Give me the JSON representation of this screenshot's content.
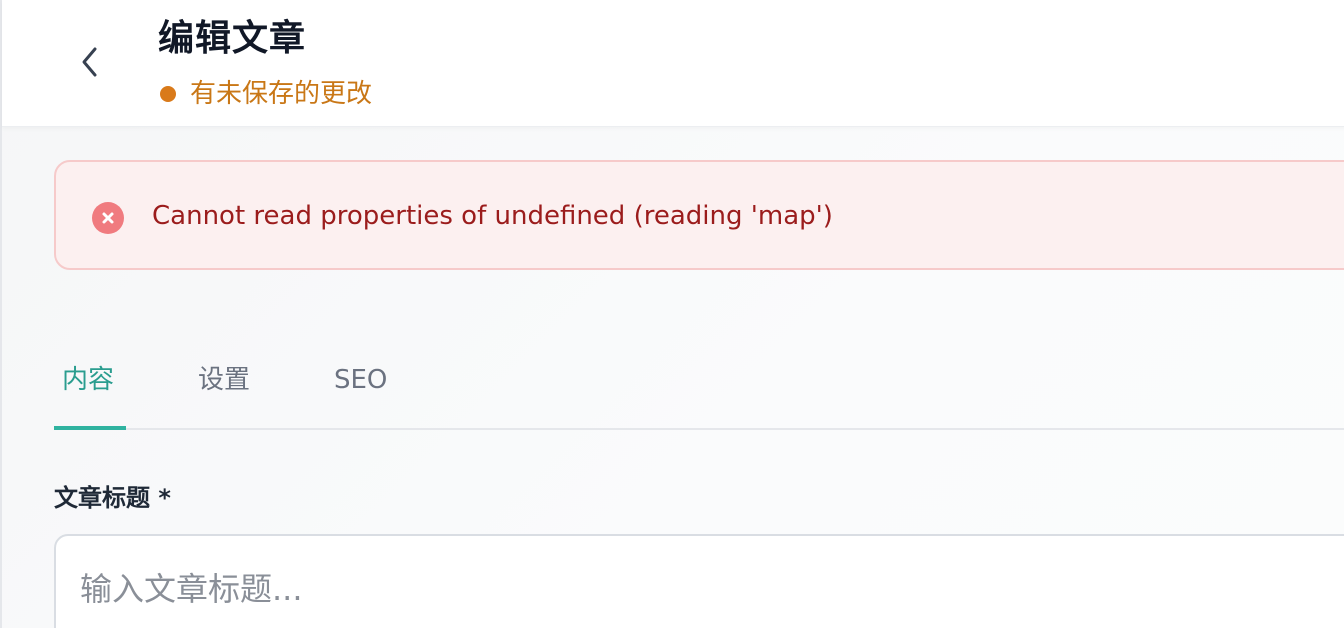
{
  "header": {
    "title": "编辑文章",
    "status_text": "有未保存的更改",
    "status_color": "#d97a1a"
  },
  "alert": {
    "message": "Cannot read properties of undefined (reading 'map')",
    "icon": "close-circle-icon",
    "color": "#9b1c1c"
  },
  "tabs": [
    {
      "label": "内容",
      "active": true
    },
    {
      "label": "设置",
      "active": false
    },
    {
      "label": "SEO",
      "active": false
    }
  ],
  "form": {
    "title_label": "文章标题 *",
    "title_placeholder": "输入文章标题...",
    "title_value": ""
  },
  "colors": {
    "accent": "#2fb3a0",
    "warning": "#d97a1a",
    "error_bg": "#fcf0f0",
    "error_border": "#f6caca"
  }
}
